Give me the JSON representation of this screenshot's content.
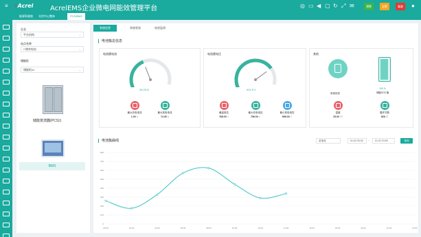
{
  "app": {
    "brand": "Acrel",
    "title": "AcrelEMS企业微电网能效管理平台"
  },
  "header_badges": [
    {
      "label": "预警",
      "color": "#3cb44b"
    },
    {
      "label": "告警",
      "color": "#f5a623"
    },
    {
      "label": "事故",
      "color": "#e53935"
    }
  ],
  "tabs": [
    "能源驾驶舱",
    "光伏中心整体",
    "PCS/BMS"
  ],
  "filters": {
    "company_label": "企业",
    "company_value": "平台机构",
    "site_label": "站点名称",
    "site_value": "C储充电站",
    "cabinet_label": "储能柜",
    "cabinet_value": "储能柜#1"
  },
  "devices": [
    {
      "label": "储能变流器(PCS)1"
    },
    {
      "label": "BMS"
    }
  ],
  "subtabs": [
    "系统信息",
    "系统状态",
    "电池监测"
  ],
  "overview": {
    "title": "电池簇总信息",
    "current_panel": {
      "title": "电池簇电流",
      "gauge_value": "30.25 A",
      "gauge_fraction": 0.42,
      "metrics": [
        {
          "label": "最大充电电流",
          "value": "1.00",
          "unit": "A",
          "color": "#e9626a"
        },
        {
          "label": "最大放电电流",
          "value": "74.05",
          "unit": "A",
          "color": "#37b39e"
        }
      ]
    },
    "voltage_panel": {
      "title": "电池簇电压",
      "gauge_value": "611.8 V",
      "gauge_fraction": 0.7,
      "metrics": [
        {
          "label": "最高电压",
          "value": "768.00",
          "unit": "V",
          "color": "#e9626a"
        },
        {
          "label": "最大充电电压",
          "value": "756.00",
          "unit": "V",
          "color": "#37b39e"
        },
        {
          "label": "最小放电电压",
          "value": "656.00",
          "unit": "V",
          "color": "#4aa8e6"
        }
      ]
    },
    "other_panel": {
      "title": "其他",
      "status_label": "系统状态",
      "soc_value": "100 %",
      "soc_label": "储能SOC值",
      "metrics": [
        {
          "label": "温度",
          "value": "25.00",
          "unit": "℃",
          "color": "#e9626a"
        },
        {
          "label": "循环次数",
          "value": "828",
          "unit": "次",
          "color": "#37b39e"
        }
      ]
    }
  },
  "curve": {
    "title": "电池簇曲线",
    "select_value": "总电流",
    "date_start": "01-02 00:00",
    "date_sep": "~",
    "date_end": "01-02 23:59",
    "query_label": "查询"
  },
  "chart_data": {
    "type": "line",
    "x": [
      "00:00",
      "02:00",
      "04:00",
      "06:00",
      "08:00",
      "10:00",
      "12:00",
      "14:00",
      "16:00",
      "18:00",
      "20:00",
      "22:00",
      "24:00"
    ],
    "series": [
      {
        "values": [
          260,
          175,
          330,
          570,
          625,
          445,
          290,
          340,
          null,
          null,
          null,
          null,
          null
        ]
      }
    ],
    "y_ticks": [
      "0",
      "100",
      "200",
      "300",
      "400",
      "500",
      "600",
      "700",
      "800"
    ],
    "ylim": [
      0,
      800
    ],
    "grid": true,
    "line_color": "#40c2c4"
  }
}
